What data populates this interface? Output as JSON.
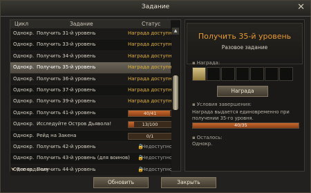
{
  "window": {
    "title": "Задание"
  },
  "table": {
    "headers": {
      "cycle": "Цикл",
      "task": "Задание",
      "status": "Статус"
    },
    "rows": [
      {
        "cycle": "Однокр.",
        "task": "Получить 31-й уровень",
        "status": "Награда доступна",
        "kind": "available"
      },
      {
        "cycle": "Однокр.",
        "task": "Получить 33-й уровень",
        "status": "Награда доступна",
        "kind": "available"
      },
      {
        "cycle": "Однокр.",
        "task": "Получить 34-й уровень",
        "status": "Награда доступна",
        "kind": "available"
      },
      {
        "cycle": "Однокр.",
        "task": "Получить 35-й уровень",
        "status": "Награда доступна",
        "kind": "available",
        "selected": true
      },
      {
        "cycle": "Однокр.",
        "task": "Получить 36-й уровень",
        "status": "Награда доступна",
        "kind": "available"
      },
      {
        "cycle": "Однокр.",
        "task": "Получить 37-й уровень",
        "status": "Награда доступна",
        "kind": "available"
      },
      {
        "cycle": "Однокр.",
        "task": "Получить 39-й уровень",
        "status": "Награда доступна",
        "kind": "available"
      },
      {
        "cycle": "Однокр.",
        "task": "Получить 41-й уровень",
        "status": "40/41",
        "kind": "progress",
        "progress": 0.97
      },
      {
        "cycle": "Однокр.",
        "task": "Исследуйте Остров Дьявола!",
        "status": "13/100",
        "kind": "progress",
        "progress": 0.13
      },
      {
        "cycle": "Однокр.",
        "task": "Рейд на Закена",
        "status": "0/1",
        "kind": "progress",
        "progress": 0
      },
      {
        "cycle": "Однокр.",
        "task": "Получить 42-й уровень",
        "status": "Недоступно",
        "kind": "locked"
      },
      {
        "cycle": "Однокр.",
        "task": "Получить 43-й уровень (для воинов)",
        "status": "Недоступно",
        "kind": "locked"
      },
      {
        "cycle": "Однокр.",
        "task": "Получить 44-й уровень",
        "status": "Недоступно",
        "kind": "locked"
      }
    ]
  },
  "filter": {
    "label": "Все задания"
  },
  "detail": {
    "quest_name": "Получить 35-й уровень",
    "quest_type": "Разовое задание",
    "reward_label": "Награда:",
    "reward_button": "Награда",
    "conditions_label": "Условия завершения:",
    "conditions_text": "Награда выдается единовременно при получении 35-го уровня.",
    "progress_text": "40/35",
    "progress": 1,
    "remaining_label": "Осталось:",
    "remaining_value": "Однокр."
  },
  "footer": {
    "refresh": "Обновить",
    "close": "Закрыть"
  }
}
